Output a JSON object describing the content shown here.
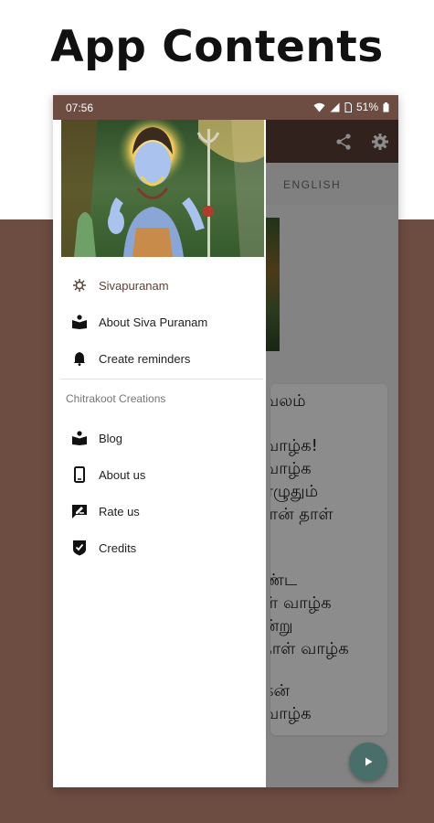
{
  "headline": "App Contents",
  "status_bar": {
    "time": "07:56",
    "battery": "51%"
  },
  "tabs": {
    "english": "ENGLISH"
  },
  "background_text": {
    "lines": [
      "வலம்",
      "",
      "வாழ்க!",
      "வாழ்க",
      "பொழுதும்",
      "நாதான் தாள்",
      "",
      "",
      "ண்ட",
      "ள் வாழ்க",
      "ன்று",
      "தாள் வாழ்க",
      "",
      "கன்",
      "வாழ்க"
    ]
  },
  "drawer": {
    "header_image": "Lord Shiva illustration",
    "menu": [
      {
        "label": "Sivapuranam",
        "icon": "flower-ornament-icon",
        "active": true
      },
      {
        "label": "About Siva Puranam",
        "icon": "book-reader-icon"
      },
      {
        "label": "Create reminders",
        "icon": "bell-icon"
      }
    ],
    "section_title": "Chitrakoot Creations",
    "section_items": [
      {
        "label": "Blog",
        "icon": "book-reader-icon"
      },
      {
        "label": "About us",
        "icon": "phone-icon"
      },
      {
        "label": "Rate us",
        "icon": "rate-review-icon"
      },
      {
        "label": "Credits",
        "icon": "verified-shield-icon"
      }
    ]
  },
  "colors": {
    "brand": "#6d4c41",
    "appbar": "#5b3f35",
    "fab": "#4a6f6a",
    "active_item": "#5d4037"
  }
}
